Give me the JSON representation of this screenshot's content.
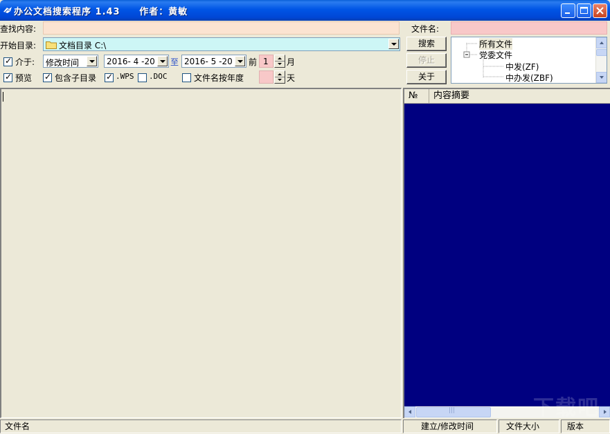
{
  "window": {
    "title": "办公文档搜索程序 1.43     作者：黄敏"
  },
  "search": {
    "content_label": "查找内容:",
    "content_value": "",
    "filename_label": "文件名:",
    "filename_value": ""
  },
  "start_dir": {
    "label": "开始目录:",
    "value": "文档目录 C:\\"
  },
  "date_filter": {
    "between_label": "介于:",
    "between_checked": true,
    "field_value": "修改时间",
    "from_date": "2016- 4 -20",
    "to_label": "至",
    "to_date": "2016- 5 -20",
    "before_label": "前",
    "months_value": "1",
    "month_unit": "月"
  },
  "options": {
    "preview_label": "预览",
    "preview_checked": true,
    "subdir_label": "包含子目录",
    "subdir_checked": true,
    "wps_label": ".WPS",
    "wps_checked": true,
    "doc_label": ".DOC",
    "doc_checked": false,
    "year_label": "文件名按年度",
    "year_checked": false,
    "days_value": "",
    "day_unit": "天"
  },
  "buttons": {
    "search": "搜索",
    "stop": "停止",
    "about": "关于"
  },
  "tree": {
    "items": [
      {
        "label": "所有文件"
      },
      {
        "label": "党委文件"
      },
      {
        "label": "中发(ZF)"
      },
      {
        "label": "中办发(ZBF)"
      }
    ]
  },
  "result_list": {
    "columns": [
      "№",
      "内容摘要"
    ]
  },
  "watermark": "下载吧",
  "statusbar": {
    "filename": "文件名",
    "modified": "建立/修改时间",
    "size": "文件大小",
    "version": "版本"
  },
  "colors": {
    "title_blue": "#0055e5",
    "input_peach": "#fbe3d1",
    "input_pink": "#f8c8c8",
    "dir_cyan": "#cdf6f6",
    "list_navy": "#000080"
  }
}
